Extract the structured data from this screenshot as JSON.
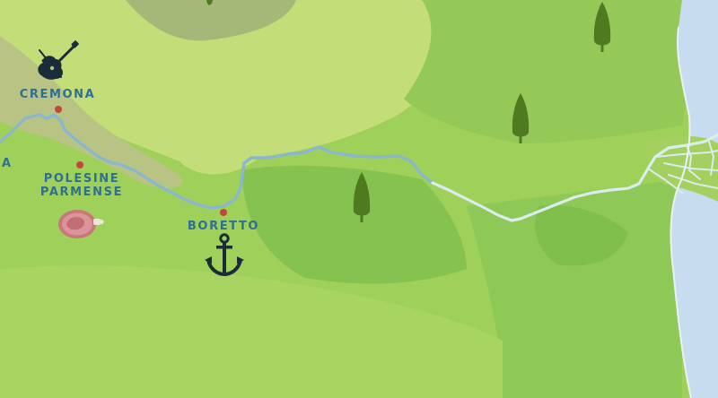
{
  "map": {
    "colors": {
      "river": "#8ab6cf",
      "river_delta": "#dcebf0",
      "sea": "#c7dcef",
      "city_dot": "#c2473a",
      "label": "#2f6f93",
      "tree": "#4f7a1f",
      "icon": "#1b2b3a"
    },
    "labels": {
      "cremona": "CREMONA",
      "polesine_line1": "POLESINE",
      "polesine_line2": "PARMENSE",
      "boretto": "BORETTO",
      "edge_fragment": "A"
    },
    "icons": {
      "cremona": "violin-icon",
      "polesine": "ham-icon",
      "boretto": "anchor-icon",
      "trees": "cypress-tree-icon"
    }
  }
}
